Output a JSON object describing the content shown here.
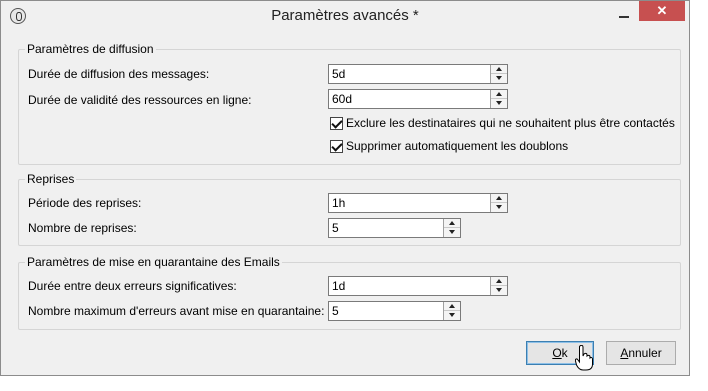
{
  "window": {
    "title": "Paramètres avancés *",
    "close_glyph": "✕"
  },
  "diffusion": {
    "title": "Paramètres de diffusion",
    "duration_label": "Durée de diffusion des messages:",
    "duration_value": "5d",
    "validity_label": "Durée de validité des ressources en ligne:",
    "validity_value": "60d",
    "exclude_label": "Exclure les destinataires qui ne souhaitent plus être contactés",
    "exclude_checked": true,
    "dedupe_label": "Supprimer automatiquement les doublons",
    "dedupe_checked": true
  },
  "retries": {
    "title": "Reprises",
    "period_label": "Période des reprises:",
    "period_value": "1h",
    "count_label": "Nombre de reprises:",
    "count_value": "5"
  },
  "quarantine": {
    "title": "Paramètres de mise en quarantaine des Emails",
    "interval_label": "Durée entre deux erreurs significatives:",
    "interval_value": "1d",
    "max_label": "Nombre maximum d'erreurs avant mise en quarantaine:",
    "max_value": "5"
  },
  "buttons": {
    "ok_mnemonic": "O",
    "ok_rest": "k",
    "cancel_mnemonic": "A",
    "cancel_rest": "nnuler"
  }
}
